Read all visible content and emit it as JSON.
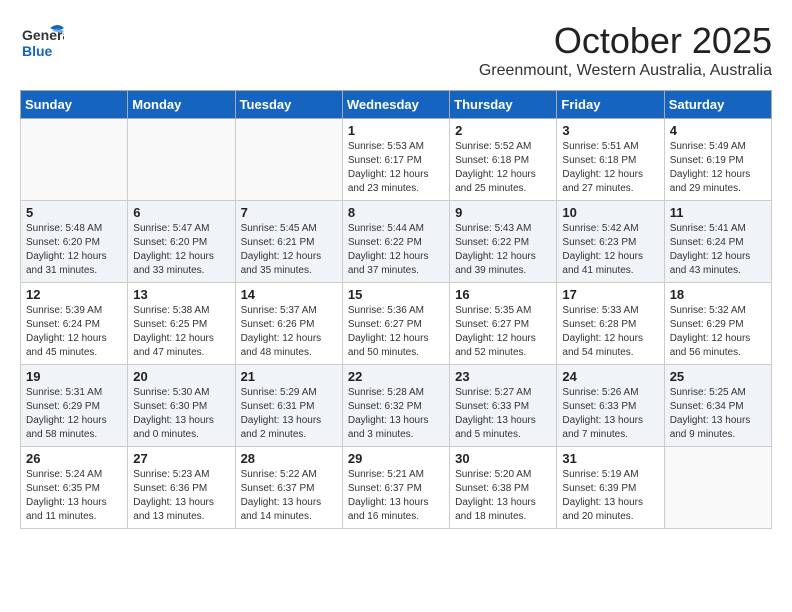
{
  "header": {
    "logo_general": "General",
    "logo_blue": "Blue",
    "month": "October 2025",
    "location": "Greenmount, Western Australia, Australia"
  },
  "weekdays": [
    "Sunday",
    "Monday",
    "Tuesday",
    "Wednesday",
    "Thursday",
    "Friday",
    "Saturday"
  ],
  "weeks": [
    [
      {
        "day": "",
        "detail": ""
      },
      {
        "day": "",
        "detail": ""
      },
      {
        "day": "",
        "detail": ""
      },
      {
        "day": "1",
        "detail": "Sunrise: 5:53 AM\nSunset: 6:17 PM\nDaylight: 12 hours\nand 23 minutes."
      },
      {
        "day": "2",
        "detail": "Sunrise: 5:52 AM\nSunset: 6:18 PM\nDaylight: 12 hours\nand 25 minutes."
      },
      {
        "day": "3",
        "detail": "Sunrise: 5:51 AM\nSunset: 6:18 PM\nDaylight: 12 hours\nand 27 minutes."
      },
      {
        "day": "4",
        "detail": "Sunrise: 5:49 AM\nSunset: 6:19 PM\nDaylight: 12 hours\nand 29 minutes."
      }
    ],
    [
      {
        "day": "5",
        "detail": "Sunrise: 5:48 AM\nSunset: 6:20 PM\nDaylight: 12 hours\nand 31 minutes."
      },
      {
        "day": "6",
        "detail": "Sunrise: 5:47 AM\nSunset: 6:20 PM\nDaylight: 12 hours\nand 33 minutes."
      },
      {
        "day": "7",
        "detail": "Sunrise: 5:45 AM\nSunset: 6:21 PM\nDaylight: 12 hours\nand 35 minutes."
      },
      {
        "day": "8",
        "detail": "Sunrise: 5:44 AM\nSunset: 6:22 PM\nDaylight: 12 hours\nand 37 minutes."
      },
      {
        "day": "9",
        "detail": "Sunrise: 5:43 AM\nSunset: 6:22 PM\nDaylight: 12 hours\nand 39 minutes."
      },
      {
        "day": "10",
        "detail": "Sunrise: 5:42 AM\nSunset: 6:23 PM\nDaylight: 12 hours\nand 41 minutes."
      },
      {
        "day": "11",
        "detail": "Sunrise: 5:41 AM\nSunset: 6:24 PM\nDaylight: 12 hours\nand 43 minutes."
      }
    ],
    [
      {
        "day": "12",
        "detail": "Sunrise: 5:39 AM\nSunset: 6:24 PM\nDaylight: 12 hours\nand 45 minutes."
      },
      {
        "day": "13",
        "detail": "Sunrise: 5:38 AM\nSunset: 6:25 PM\nDaylight: 12 hours\nand 47 minutes."
      },
      {
        "day": "14",
        "detail": "Sunrise: 5:37 AM\nSunset: 6:26 PM\nDaylight: 12 hours\nand 48 minutes."
      },
      {
        "day": "15",
        "detail": "Sunrise: 5:36 AM\nSunset: 6:27 PM\nDaylight: 12 hours\nand 50 minutes."
      },
      {
        "day": "16",
        "detail": "Sunrise: 5:35 AM\nSunset: 6:27 PM\nDaylight: 12 hours\nand 52 minutes."
      },
      {
        "day": "17",
        "detail": "Sunrise: 5:33 AM\nSunset: 6:28 PM\nDaylight: 12 hours\nand 54 minutes."
      },
      {
        "day": "18",
        "detail": "Sunrise: 5:32 AM\nSunset: 6:29 PM\nDaylight: 12 hours\nand 56 minutes."
      }
    ],
    [
      {
        "day": "19",
        "detail": "Sunrise: 5:31 AM\nSunset: 6:29 PM\nDaylight: 12 hours\nand 58 minutes."
      },
      {
        "day": "20",
        "detail": "Sunrise: 5:30 AM\nSunset: 6:30 PM\nDaylight: 13 hours\nand 0 minutes."
      },
      {
        "day": "21",
        "detail": "Sunrise: 5:29 AM\nSunset: 6:31 PM\nDaylight: 13 hours\nand 2 minutes."
      },
      {
        "day": "22",
        "detail": "Sunrise: 5:28 AM\nSunset: 6:32 PM\nDaylight: 13 hours\nand 3 minutes."
      },
      {
        "day": "23",
        "detail": "Sunrise: 5:27 AM\nSunset: 6:33 PM\nDaylight: 13 hours\nand 5 minutes."
      },
      {
        "day": "24",
        "detail": "Sunrise: 5:26 AM\nSunset: 6:33 PM\nDaylight: 13 hours\nand 7 minutes."
      },
      {
        "day": "25",
        "detail": "Sunrise: 5:25 AM\nSunset: 6:34 PM\nDaylight: 13 hours\nand 9 minutes."
      }
    ],
    [
      {
        "day": "26",
        "detail": "Sunrise: 5:24 AM\nSunset: 6:35 PM\nDaylight: 13 hours\nand 11 minutes."
      },
      {
        "day": "27",
        "detail": "Sunrise: 5:23 AM\nSunset: 6:36 PM\nDaylight: 13 hours\nand 13 minutes."
      },
      {
        "day": "28",
        "detail": "Sunrise: 5:22 AM\nSunset: 6:37 PM\nDaylight: 13 hours\nand 14 minutes."
      },
      {
        "day": "29",
        "detail": "Sunrise: 5:21 AM\nSunset: 6:37 PM\nDaylight: 13 hours\nand 16 minutes."
      },
      {
        "day": "30",
        "detail": "Sunrise: 5:20 AM\nSunset: 6:38 PM\nDaylight: 13 hours\nand 18 minutes."
      },
      {
        "day": "31",
        "detail": "Sunrise: 5:19 AM\nSunset: 6:39 PM\nDaylight: 13 hours\nand 20 minutes."
      },
      {
        "day": "",
        "detail": ""
      }
    ]
  ]
}
